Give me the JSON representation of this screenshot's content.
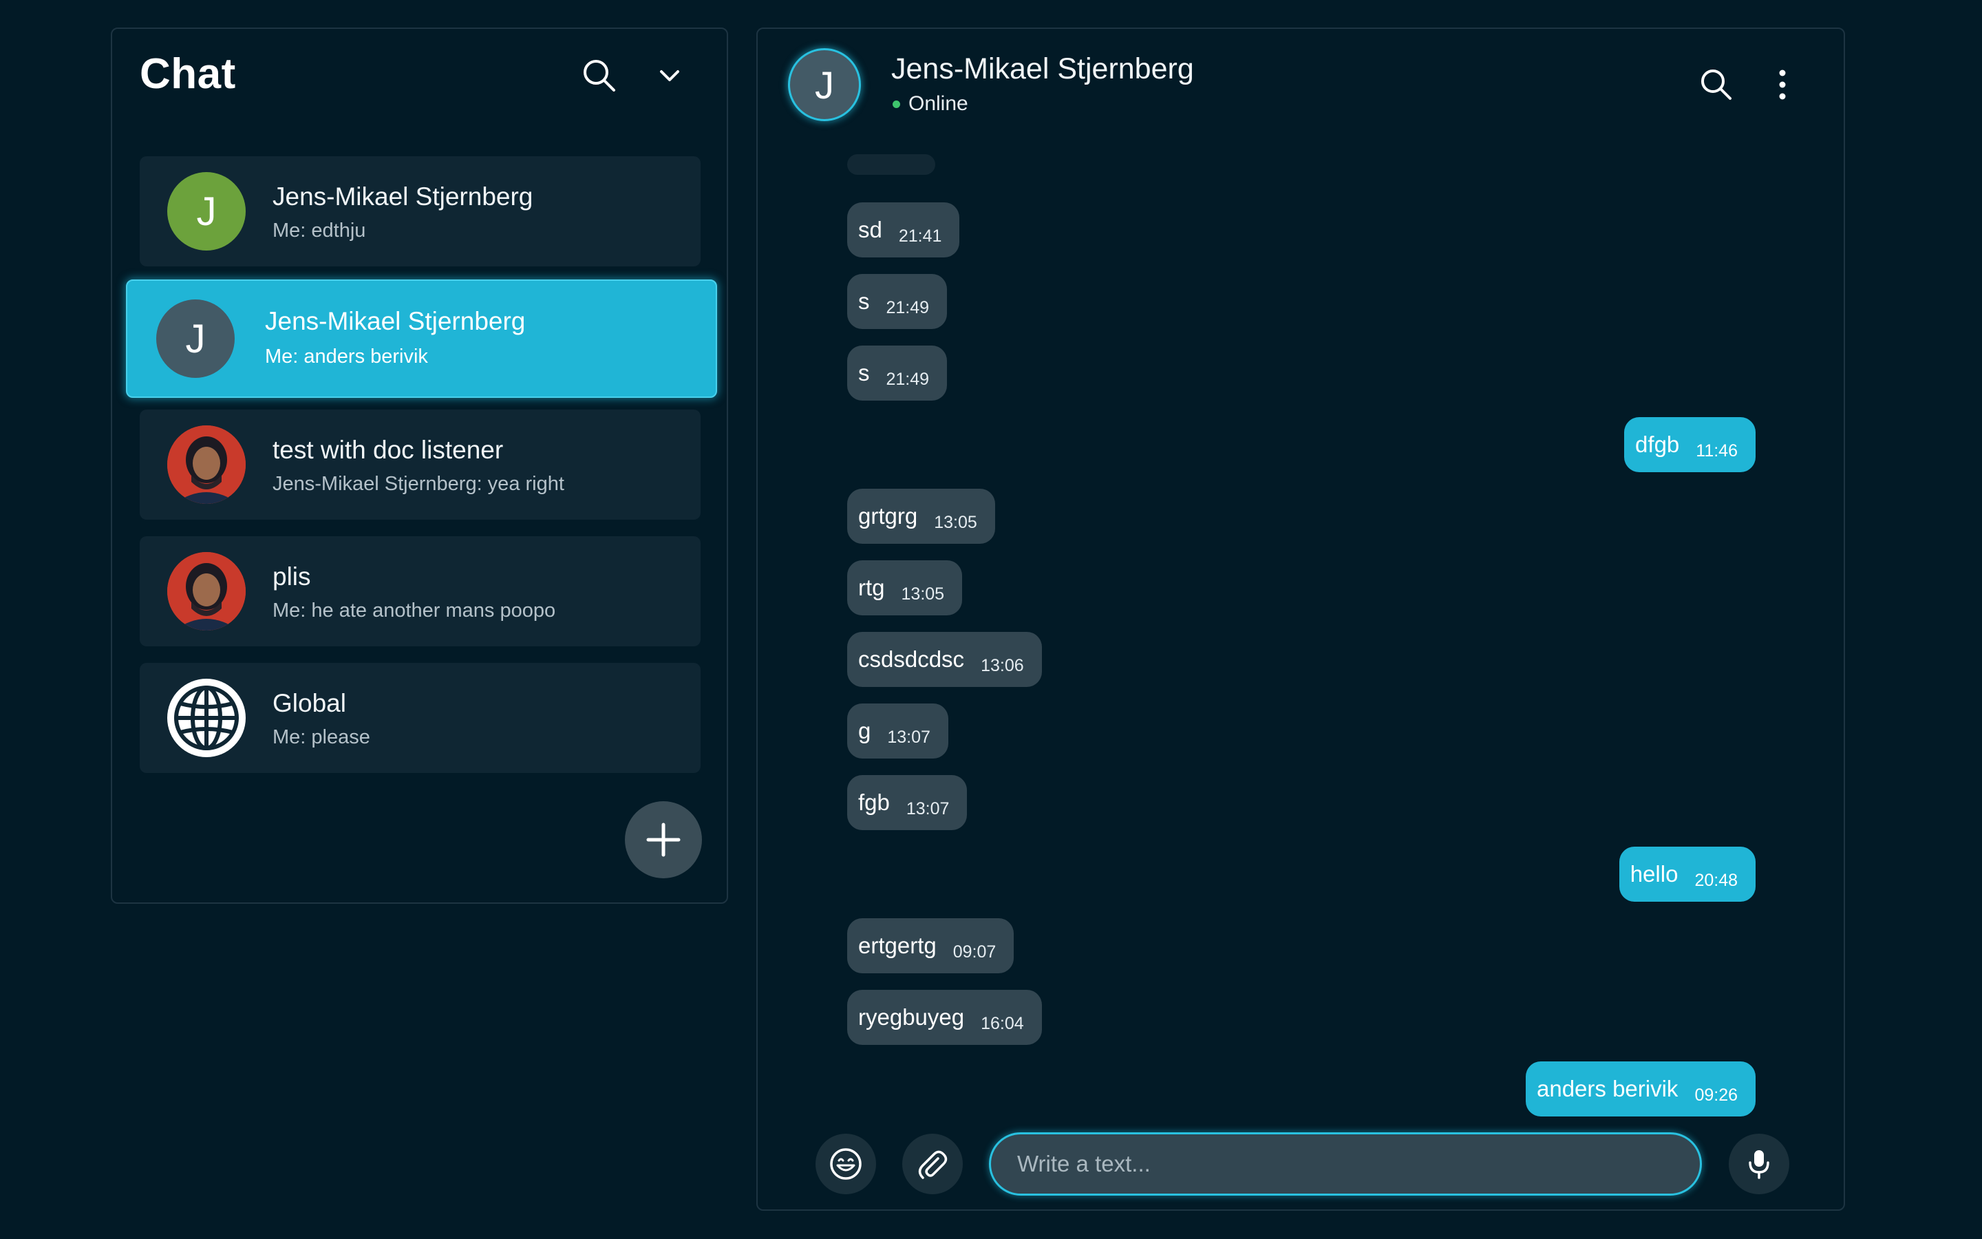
{
  "left": {
    "title": "Chat",
    "chats": [
      {
        "avatar_letter": "J",
        "avatar_color": "#6ca23c",
        "name": "Jens-Mikael Stjernberg",
        "preview": "Me: edthju",
        "active": false
      },
      {
        "avatar_letter": "J",
        "avatar_color": "#435a66",
        "name": "Jens-Mikael Stjernberg",
        "preview": "Me: anders berivik",
        "active": true
      },
      {
        "avatar_letter": "",
        "avatar_color": "#c93a2b",
        "name": "test with doc listener",
        "preview": "Jens-Mikael Stjernberg: yea right",
        "active": false
      },
      {
        "avatar_letter": "",
        "avatar_color": "#c93a2b",
        "name": "plis",
        "preview": "Me: he ate another mans poopo",
        "active": false
      },
      {
        "avatar_letter": "",
        "avatar_color": "#ffffff",
        "name": "Global",
        "preview": "Me: please",
        "active": false
      }
    ]
  },
  "header": {
    "avatar_letter": "J",
    "name": "Jens-Mikael Stjernberg",
    "status": "Online"
  },
  "messages": [
    {
      "text": "sd",
      "time": "21:41",
      "dir": "in"
    },
    {
      "text": "s",
      "time": "21:49",
      "dir": "in"
    },
    {
      "text": "s",
      "time": "21:49",
      "dir": "in"
    },
    {
      "text": "dfgb",
      "time": "11:46",
      "dir": "out"
    },
    {
      "text": "grtgrg",
      "time": "13:05",
      "dir": "in"
    },
    {
      "text": "rtg",
      "time": "13:05",
      "dir": "in"
    },
    {
      "text": "csdsdcdsc",
      "time": "13:06",
      "dir": "in"
    },
    {
      "text": "g",
      "time": "13:07",
      "dir": "in"
    },
    {
      "text": "fgb",
      "time": "13:07",
      "dir": "in"
    },
    {
      "text": "hello",
      "time": "20:48",
      "dir": "out"
    },
    {
      "text": "ertgertg",
      "time": "09:07",
      "dir": "in"
    },
    {
      "text": "ryegbuyeg",
      "time": "16:04",
      "dir": "in"
    },
    {
      "text": "anders berivik",
      "time": "09:26",
      "dir": "out"
    }
  ],
  "composer": {
    "placeholder": "Write a text..."
  },
  "colors": {
    "background": "#021a26",
    "accent": "#20b5d6",
    "incoming_bubble": "#324651",
    "online": "#3ec46d"
  }
}
